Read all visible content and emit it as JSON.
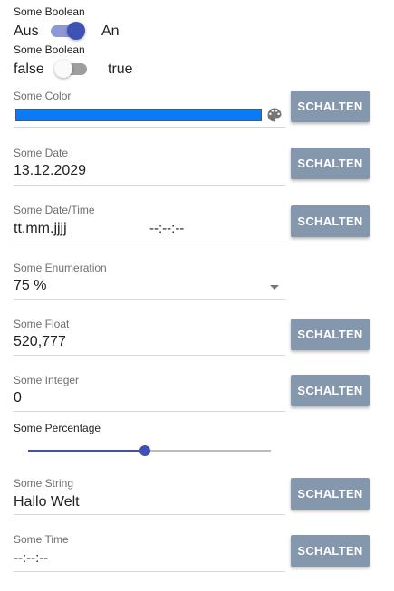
{
  "button_label": "SCHALTEN",
  "boolean_switch": {
    "label": "Some Boolean",
    "off_label": "Aus",
    "on_label": "An",
    "checked": true
  },
  "boolean_switch_2": {
    "label": "Some Boolean",
    "off_label": "false",
    "on_label": "true",
    "checked": false
  },
  "color": {
    "label": "Some Color",
    "value": "#0b7bf5",
    "icon": "palette-icon"
  },
  "date": {
    "label": "Some Date",
    "value": "13.12.2029"
  },
  "datetime": {
    "label": "Some Date/Time",
    "date_placeholder": "tt.mm.jjjj",
    "time_placeholder": "--:--:--"
  },
  "enumeration": {
    "label": "Some Enumeration",
    "value": "75 %"
  },
  "float": {
    "label": "Some Float",
    "value": "520,777"
  },
  "integer": {
    "label": "Some Integer",
    "value": "0"
  },
  "percentage": {
    "label": "Some Percentage",
    "value_fraction": 0.48
  },
  "string": {
    "label": "Some String",
    "value": "Hallo Welt"
  },
  "time": {
    "label": "Some Time",
    "placeholder": "--:--:--"
  },
  "colors": {
    "accent": "#3f51b5",
    "button_bg": "#8497ad"
  }
}
